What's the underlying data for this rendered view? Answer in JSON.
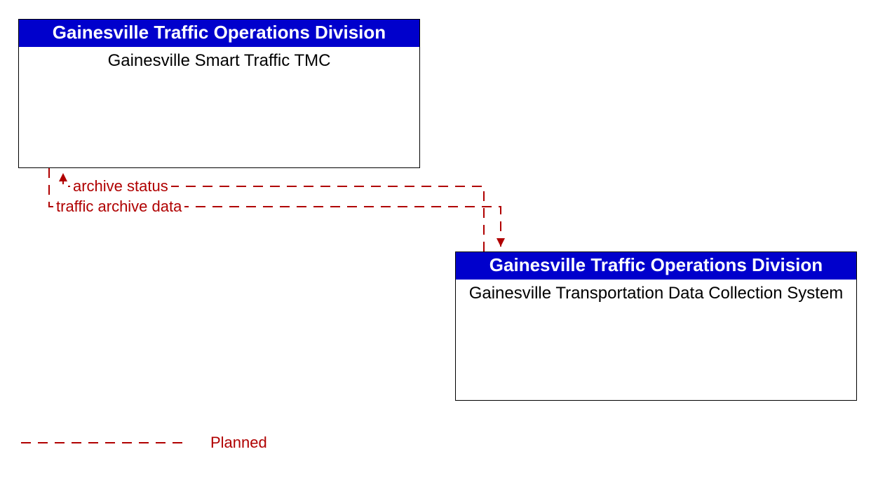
{
  "colors": {
    "header_bg": "#0000cc",
    "header_fg": "#ffffff",
    "flow_color": "#b00000",
    "border": "#000000"
  },
  "boxes": {
    "tmc": {
      "header": "Gainesville Traffic Operations Division",
      "body": "Gainesville Smart Traffic TMC"
    },
    "collection": {
      "header": "Gainesville Traffic Operations Division",
      "body": "Gainesville Transportation Data Collection System"
    }
  },
  "flows": {
    "archive_status": "archive status",
    "traffic_archive_data": "traffic archive data"
  },
  "legend": {
    "planned": "Planned"
  }
}
